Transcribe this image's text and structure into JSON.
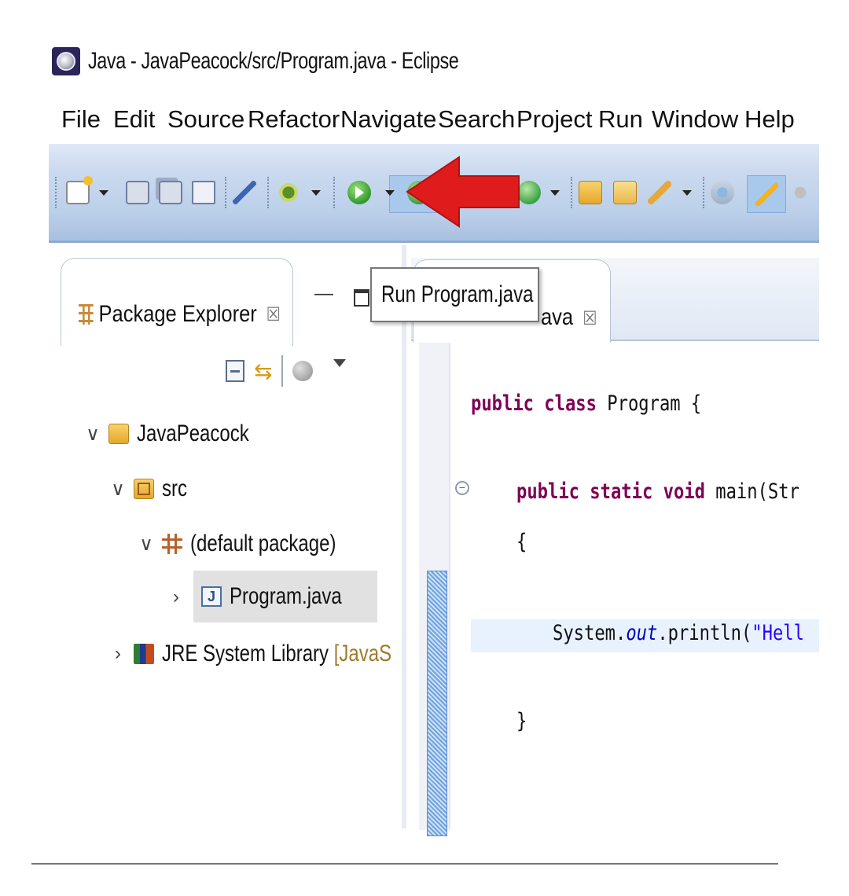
{
  "window": {
    "title": "Java - JavaPeacock/src/Program.java - Eclipse",
    "icon": "eclipse-icon"
  },
  "menubar": {
    "items": [
      "File",
      "Edit",
      "Source",
      "Refactor",
      "Navigate",
      "Search",
      "Project",
      "Run",
      "Window",
      "Help"
    ]
  },
  "toolbar": {
    "buttons": [
      "new-icon",
      "save-icon",
      "save-all-icon",
      "print-icon",
      "toggle-breakpoint-icon",
      "debug-icon",
      "run-icon",
      "external-tools-icon",
      "new-java-project-icon",
      "new-package-icon",
      "new-class-icon",
      "open-type-icon",
      "open-task-icon",
      "search-icon",
      "toggle-mark-occurrences-icon"
    ],
    "highlight_color": "#a8c8ec",
    "annotation_arrow_color": "#e01b1b"
  },
  "tooltip": {
    "text": "Run Program.java"
  },
  "package_explorer": {
    "tab_label": "Package Explorer",
    "close_glyph": "☒",
    "minimize_glyph": "—",
    "tree": [
      {
        "label": "JavaPeacock",
        "expanded": true,
        "icon": "project-folder-icon"
      },
      {
        "label": "src",
        "expanded": true,
        "icon": "source-folder-icon"
      },
      {
        "label": "(default package)",
        "expanded": true,
        "icon": "package-icon"
      },
      {
        "label": "Program.java",
        "expanded": false,
        "icon": "java-file-icon",
        "selected": true
      },
      {
        "label": "JRE System Library",
        "suffix": "[JavaS",
        "expanded": false,
        "icon": "library-icon"
      }
    ],
    "twisty_expanded": "∨",
    "twisty_collapsed": "›"
  },
  "editor": {
    "tab_label_visible": "ava",
    "close_glyph": "☒",
    "code": {
      "line1_kw": "public class",
      "line1_rest": " Program {",
      "line2_kw": "public static void",
      "line2_rest": " main(Str",
      "line3": "{",
      "line4_pre": "System.",
      "line4_field": "out",
      "line4_mid": ".println(",
      "line4_str": "\"Hell",
      "line5": "}"
    },
    "fold_glyph": "⊖"
  }
}
